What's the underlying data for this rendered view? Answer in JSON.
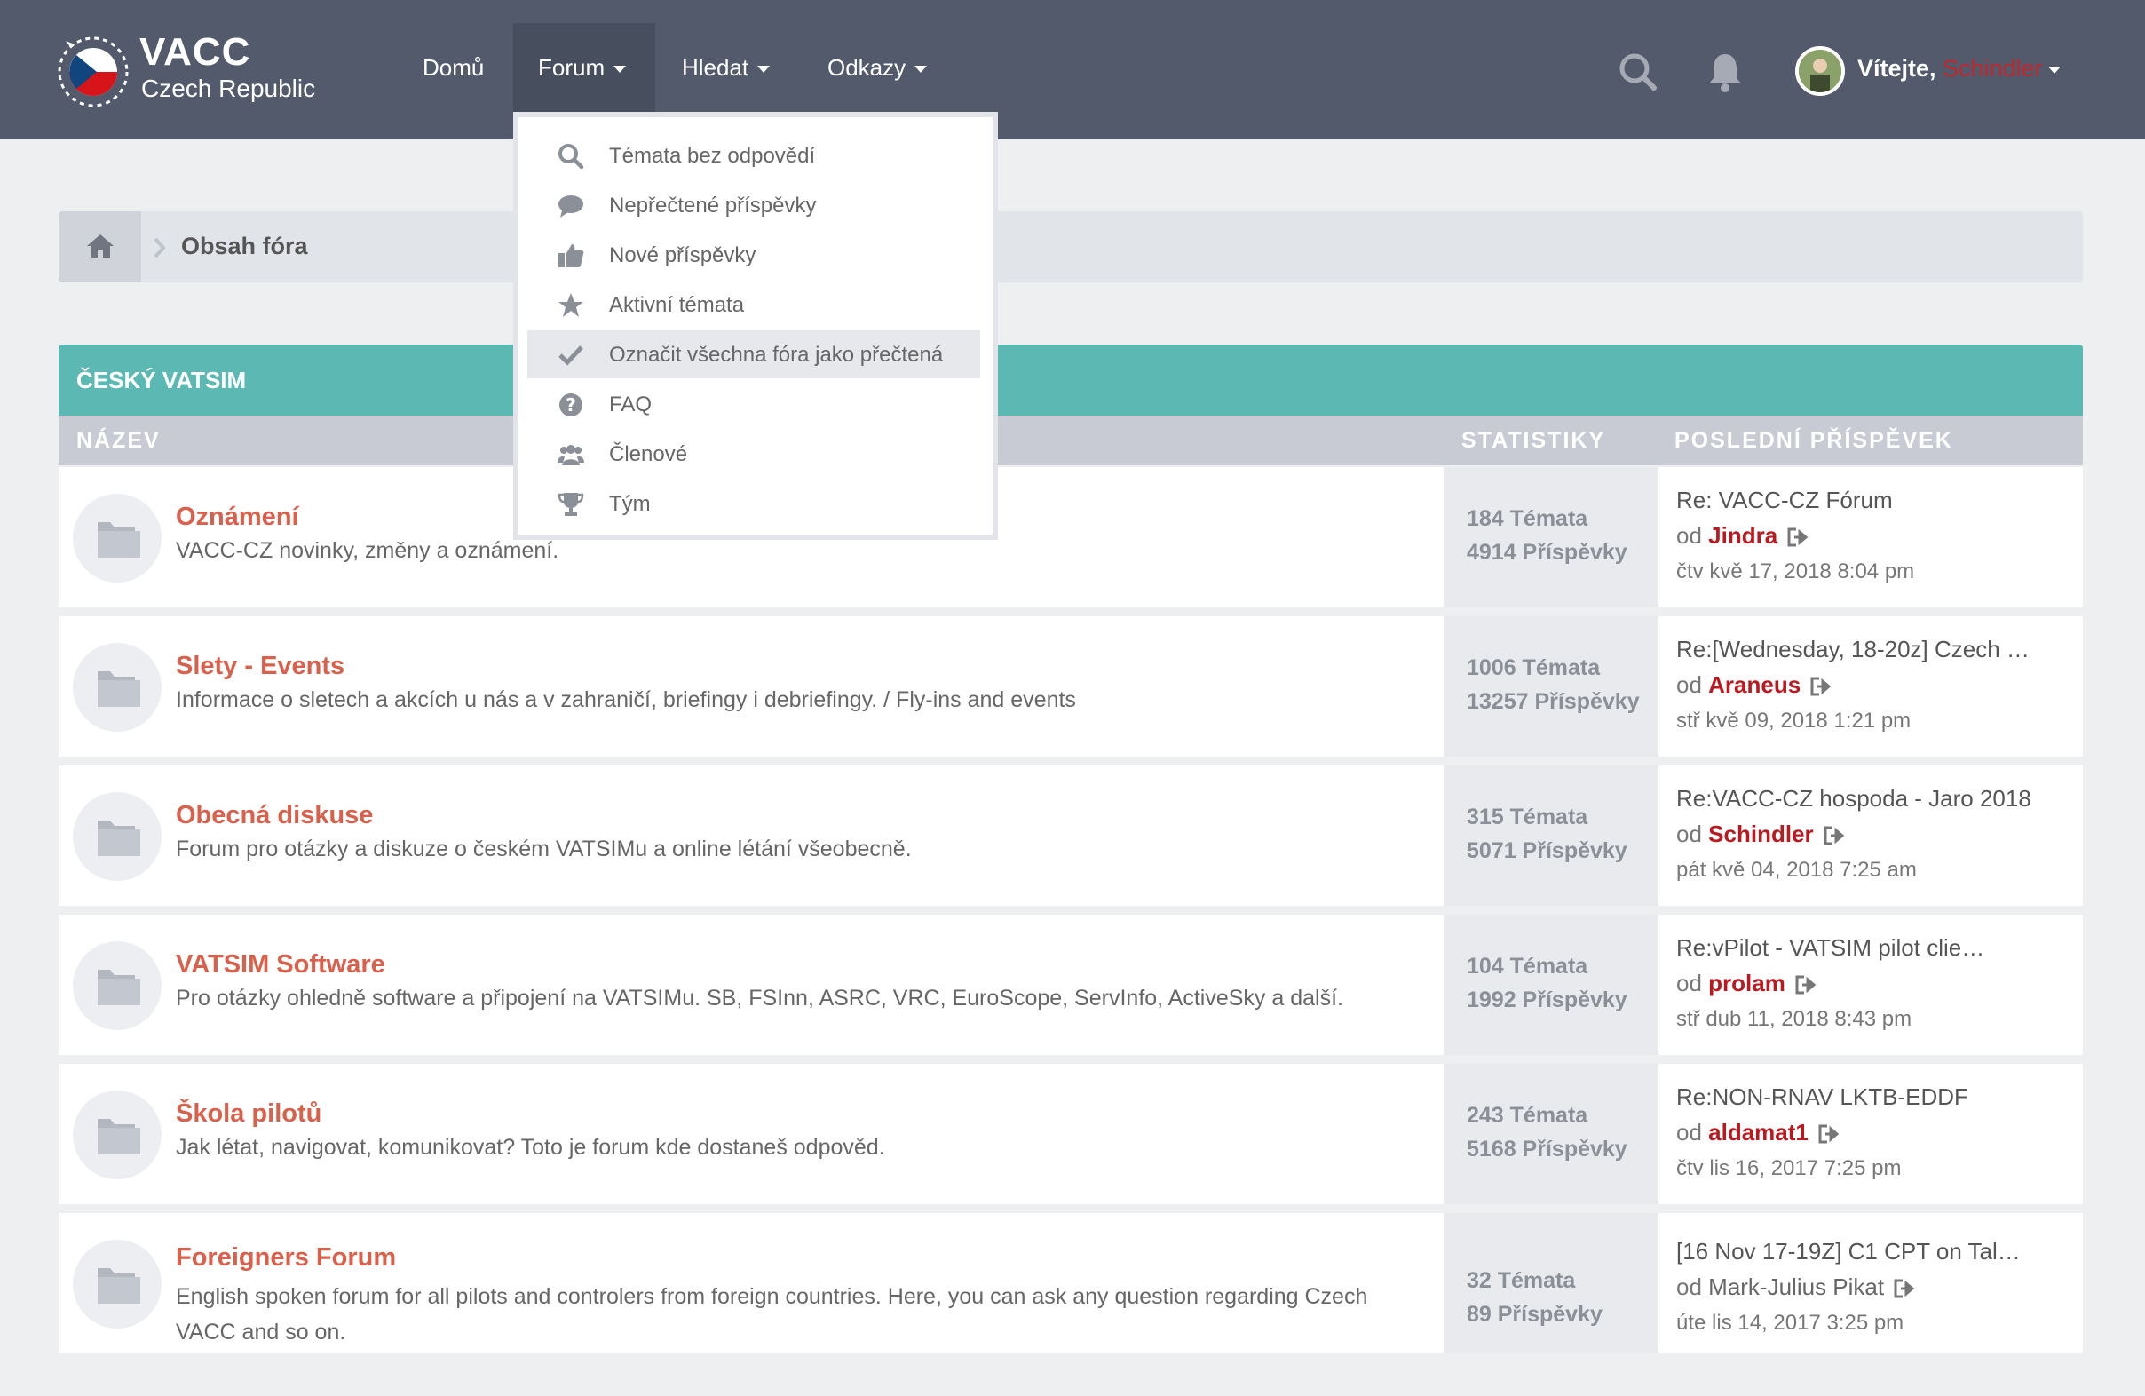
{
  "brand": {
    "title": "VACC",
    "subtitle": "Czech Republic"
  },
  "nav": {
    "home": "Domů",
    "forum": "Forum",
    "search": "Hledat",
    "links": "Odkazy"
  },
  "header": {
    "welcome": "Vítejte,",
    "username": "Schindler"
  },
  "breadcrumb": {
    "label": "Obsah fóra"
  },
  "dropdown": {
    "items": [
      {
        "label": "Témata bez odpovědí",
        "icon": "search-icon"
      },
      {
        "label": "Nepřečtené příspěvky",
        "icon": "comment-icon"
      },
      {
        "label": "Nové příspěvky",
        "icon": "thumbs-up-icon"
      },
      {
        "label": "Aktivní témata",
        "icon": "star-icon"
      },
      {
        "label": "Označit všechna fóra jako přečtená",
        "icon": "check-icon"
      },
      {
        "label": "FAQ",
        "icon": "question-icon"
      },
      {
        "label": "Členové",
        "icon": "users-icon"
      },
      {
        "label": "Tým",
        "icon": "trophy-icon"
      }
    ]
  },
  "category": {
    "title": "ČESKÝ VATSIM",
    "col_name": "NÁZEV",
    "col_stats": "STATISTIKY",
    "col_last": "POSLEDNÍ PŘÍSPĚVEK"
  },
  "forums": [
    {
      "title": "Oznámení",
      "desc": "VACC-CZ novinky, změny a oznámení.",
      "topics": "184 Témata",
      "posts": "4914 Příspěvky",
      "last_title": "Re: VACC-CZ Fórum",
      "by": "od",
      "author": "Jindra",
      "date": "čtv kvě 17, 2018 8:04 pm"
    },
    {
      "title": "Slety - Events",
      "desc": "Informace o sletech a akcích u nás a v zahraničí, briefingy i debriefingy. / Fly-ins and events",
      "topics": "1006 Témata",
      "posts": "13257 Příspěvky",
      "last_title": "Re:[Wednesday, 18-20z] Czech …",
      "by": "od",
      "author": "Araneus",
      "date": "stř kvě 09, 2018 1:21 pm"
    },
    {
      "title": "Obecná diskuse",
      "desc": "Forum pro otázky a diskuze o českém VATSIMu a online létání všeobecně.",
      "topics": "315 Témata",
      "posts": "5071 Příspěvky",
      "last_title": "Re:VACC-CZ hospoda - Jaro 2018",
      "by": "od",
      "author": "Schindler",
      "date": "pát kvě 04, 2018 7:25 am"
    },
    {
      "title": "VATSIM Software",
      "desc": "Pro otázky ohledně software a připojení na VATSIMu. SB, FSInn, ASRC, VRC, EuroScope, ServInfo, ActiveSky a další.",
      "topics": "104 Témata",
      "posts": "1992 Příspěvky",
      "last_title": "Re:vPilot - VATSIM pilot clie…",
      "by": "od",
      "author": "prolam",
      "date": "stř dub 11, 2018 8:43 pm"
    },
    {
      "title": "Škola pilotů",
      "desc": "Jak létat, navigovat, komunikovat? Toto je forum kde dostaneš odpověd.",
      "topics": "243 Témata",
      "posts": "5168 Příspěvky",
      "last_title": "Re:NON-RNAV LKTB-EDDF",
      "by": "od",
      "author": "aldamat1",
      "date": "čtv lis 16, 2017 7:25 pm"
    },
    {
      "title": "Foreigners Forum",
      "desc": "English spoken forum for all pilots and controlers from foreign countries. Here, you can ask any question regarding Czech VACC and so on.",
      "topics": "32 Témata",
      "posts": "89 Příspěvky",
      "last_title": "[16 Nov 17-19Z] C1 CPT on Tal…",
      "by": "od",
      "author": "Mark-Julius Pikat",
      "date": "úte lis 14, 2017 3:25 pm"
    }
  ],
  "colors": {
    "header": "#525a6c",
    "accent": "#5cb8b2",
    "title": "#d9604a",
    "author": "#b9191f"
  }
}
